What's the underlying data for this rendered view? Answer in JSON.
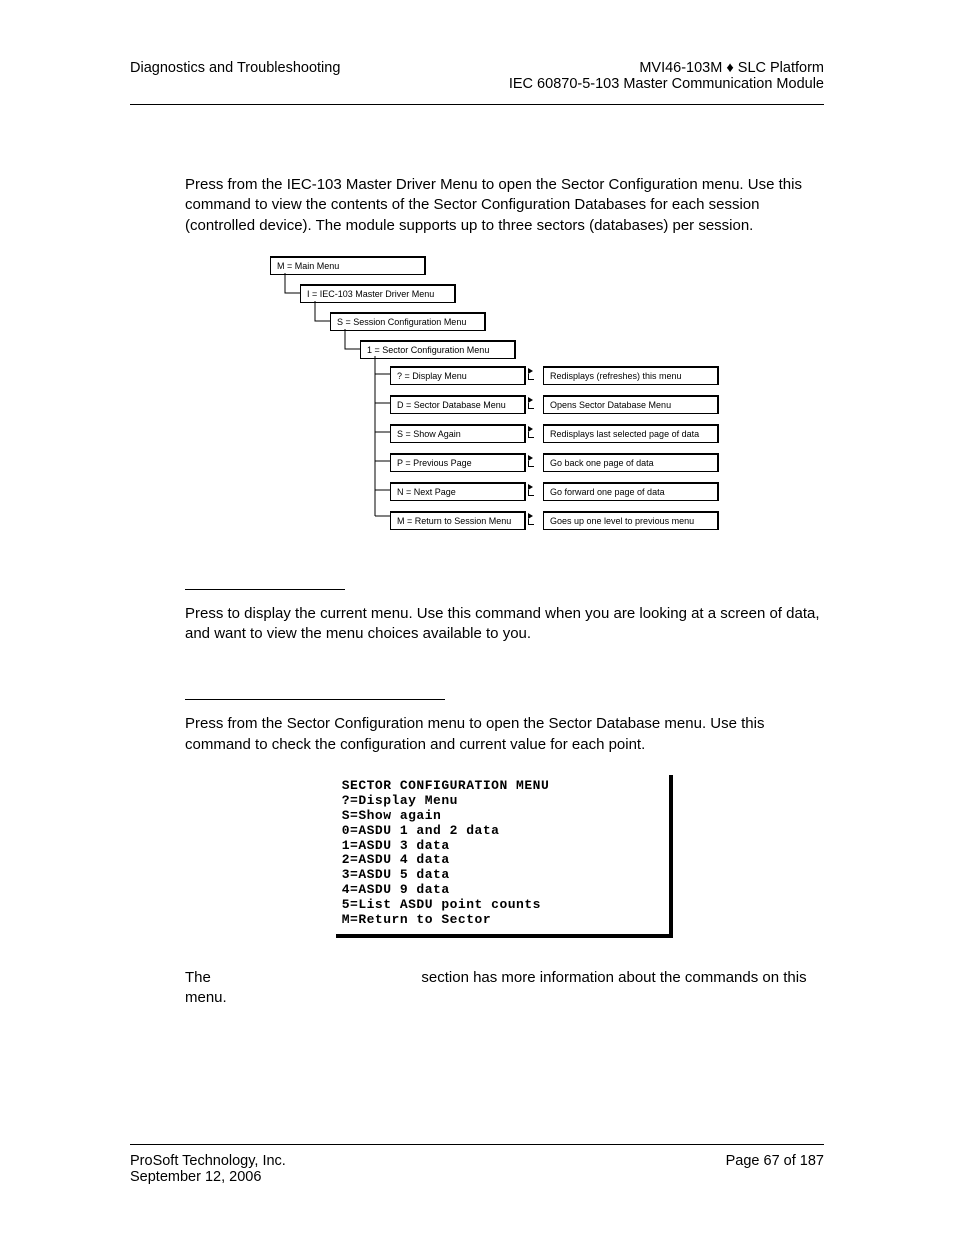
{
  "header": {
    "left": "Diagnostics and Troubleshooting",
    "rightLine1": "MVI46-103M ♦ SLC Platform",
    "rightLine2": "IEC 60870-5-103 Master Communication Module"
  },
  "para1": "Press       from the IEC-103 Master Driver Menu to open the Sector Configuration menu. Use this command to view the contents of the Sector Configuration Databases for each session (controlled device). The module supports up to three sectors (databases) per session.",
  "menuTree": {
    "level0": "M = Main Menu",
    "level1": "I = IEC-103 Master Driver Menu",
    "level2": "S = Session Configuration Menu",
    "level3": "1 = Sector Configuration Menu",
    "items": [
      {
        "left": "? = Display Menu",
        "right": "Redisplays (refreshes) this menu"
      },
      {
        "left": "D = Sector Database Menu",
        "right": "Opens Sector Database Menu"
      },
      {
        "left": "S = Show Again",
        "right": "Redisplays last selected page of data"
      },
      {
        "left": "P = Previous Page",
        "right": "Go back one page of data"
      },
      {
        "left": "N = Next Page",
        "right": "Go forward one page of data"
      },
      {
        "left": "M = Return to Session Menu",
        "right": "Goes up one level to previous menu"
      }
    ]
  },
  "para2": "Press       to display the current menu. Use this command when you are looking at a screen of data, and want to view the menu choices available to you.",
  "para3": "Press       from the Sector Configuration menu to open the Sector Database menu. Use this command to check the configuration and current value for each point.",
  "terminal": [
    "SECTOR CONFIGURATION MENU",
    " ?=Display Menu",
    " S=Show again",
    " 0=ASDU 1 and 2 data",
    " 1=ASDU 3 data",
    " 2=ASDU 4 data",
    " 3=ASDU 5 data",
    " 4=ASDU 9 data",
    " 5=List ASDU point counts",
    " M=Return to Sector"
  ],
  "para4a": "The",
  "para4b": "section has more information about the commands on this menu.",
  "footer": {
    "leftLine1": "ProSoft Technology, Inc.",
    "leftLine2": "September 12, 2006",
    "right": "Page 67 of 187"
  }
}
